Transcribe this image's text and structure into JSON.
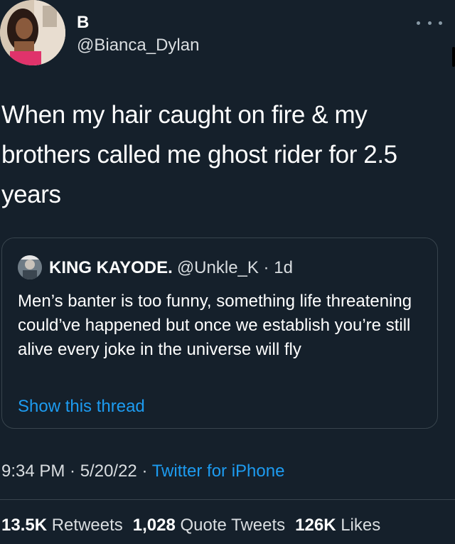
{
  "author": {
    "display_name": "B",
    "handle": "@Bianca_Dylan"
  },
  "tweet": {
    "text": "When my hair caught on fire & my brothers called me ghost rider for 2.5 years"
  },
  "quoted_tweet": {
    "name": "KING KAYODE.",
    "meta": "@Unkle_K · 1d",
    "text": "Men’s banter is too funny, something life threatening could’ve happened but once we establish you’re still alive every joke in the universe will fly",
    "show_thread": "Show this thread"
  },
  "meta": {
    "time": "9:34 PM · 5/20/22 · ",
    "source": "Twitter for iPhone"
  },
  "stats": {
    "retweets_count": "13.5K",
    "retweets_label": "Retweets",
    "quote_count": "1,028",
    "quote_label": "Quote Tweets",
    "likes_count": "126K",
    "likes_label": "Likes"
  },
  "colors": {
    "background": "#15202b",
    "link": "#1d9bf0",
    "border": "#38444d"
  },
  "icons": {
    "more": "more-options-icon"
  }
}
